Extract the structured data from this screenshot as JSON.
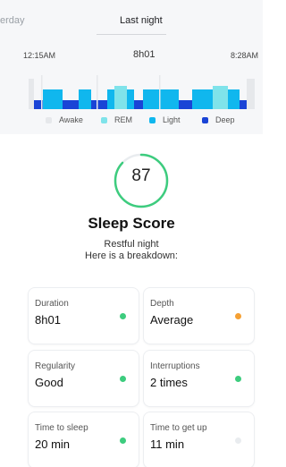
{
  "tabs": {
    "previous": "erday",
    "current": "Last night"
  },
  "timeline": {
    "start": "12:15AM",
    "duration": "8h01",
    "end": "8:28AM"
  },
  "legend": [
    {
      "label": "Awake",
      "color": "#e6e8eb"
    },
    {
      "label": "REM",
      "color": "#7fe3ea"
    },
    {
      "label": "Light",
      "color": "#10b7ee"
    },
    {
      "label": "Deep",
      "color": "#1a44d6"
    }
  ],
  "colors": {
    "good": "#3dcc7e",
    "average": "#f5a033",
    "neutral": "#e9ecef",
    "ring": "#3dcc7e"
  },
  "score": {
    "value": "87",
    "progress": 0.87,
    "title": "Sleep Score",
    "subtitle_line1": "Restful night",
    "subtitle_line2": "Here is a breakdown:"
  },
  "cards": [
    {
      "label": "Duration",
      "value": "8h01",
      "status": "good"
    },
    {
      "label": "Depth",
      "value": "Average",
      "status": "average"
    },
    {
      "label": "Regularity",
      "value": "Good",
      "status": "good"
    },
    {
      "label": "Interruptions",
      "value": "2 times",
      "status": "good"
    },
    {
      "label": "Time to sleep",
      "value": "20 min",
      "status": "good"
    },
    {
      "label": "Time to get up",
      "value": "11 min",
      "status": "neutral"
    }
  ]
}
